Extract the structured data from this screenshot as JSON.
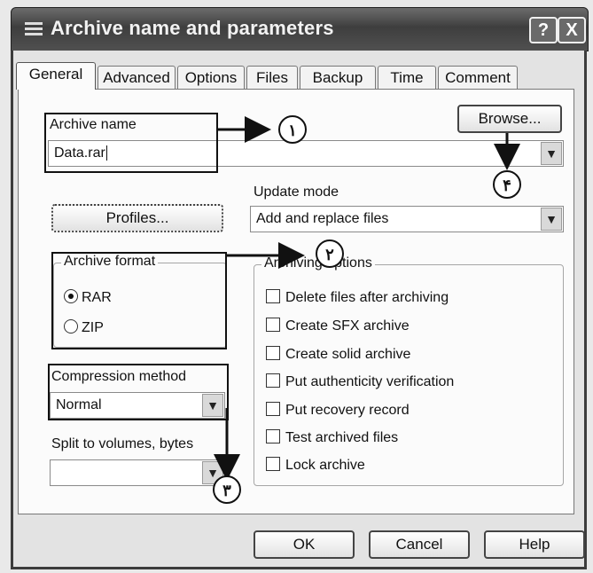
{
  "window": {
    "title": "Archive name and parameters"
  },
  "titlebar_buttons": {
    "help": "?",
    "close": "X"
  },
  "tabs": [
    {
      "label": "General",
      "active": true
    },
    {
      "label": "Advanced",
      "active": false
    },
    {
      "label": "Options",
      "active": false
    },
    {
      "label": "Files",
      "active": false
    },
    {
      "label": "Backup",
      "active": false
    },
    {
      "label": "Time",
      "active": false
    },
    {
      "label": "Comment",
      "active": false
    }
  ],
  "general": {
    "archive_name_label": "Archive name",
    "archive_name_value": "Data.rar",
    "browse_label": "Browse...",
    "update_mode_label": "Update mode",
    "update_mode_value": "Add and replace files",
    "profiles_label": "Profiles...",
    "archive_format": {
      "legend": "Archive format",
      "options": [
        {
          "label": "RAR",
          "selected": true
        },
        {
          "label": "ZIP",
          "selected": false
        }
      ]
    },
    "compression_method_label": "Compression method",
    "compression_method_value": "Normal",
    "split_label": "Split to volumes, bytes",
    "split_value": "",
    "archiving_options": {
      "legend": "Archiving options",
      "items": [
        {
          "label": "Delete files after archiving",
          "checked": false
        },
        {
          "label": "Create SFX archive",
          "checked": false
        },
        {
          "label": "Create solid archive",
          "checked": false
        },
        {
          "label": "Put authenticity verification",
          "checked": false
        },
        {
          "label": "Put recovery record",
          "checked": false
        },
        {
          "label": "Test archived files",
          "checked": false
        },
        {
          "label": "Lock archive",
          "checked": false
        }
      ]
    }
  },
  "buttons": {
    "ok": "OK",
    "cancel": "Cancel",
    "help": "Help"
  },
  "annotations": {
    "n1": "١",
    "n2": "٢",
    "n3": "٣",
    "n4": "۴"
  }
}
